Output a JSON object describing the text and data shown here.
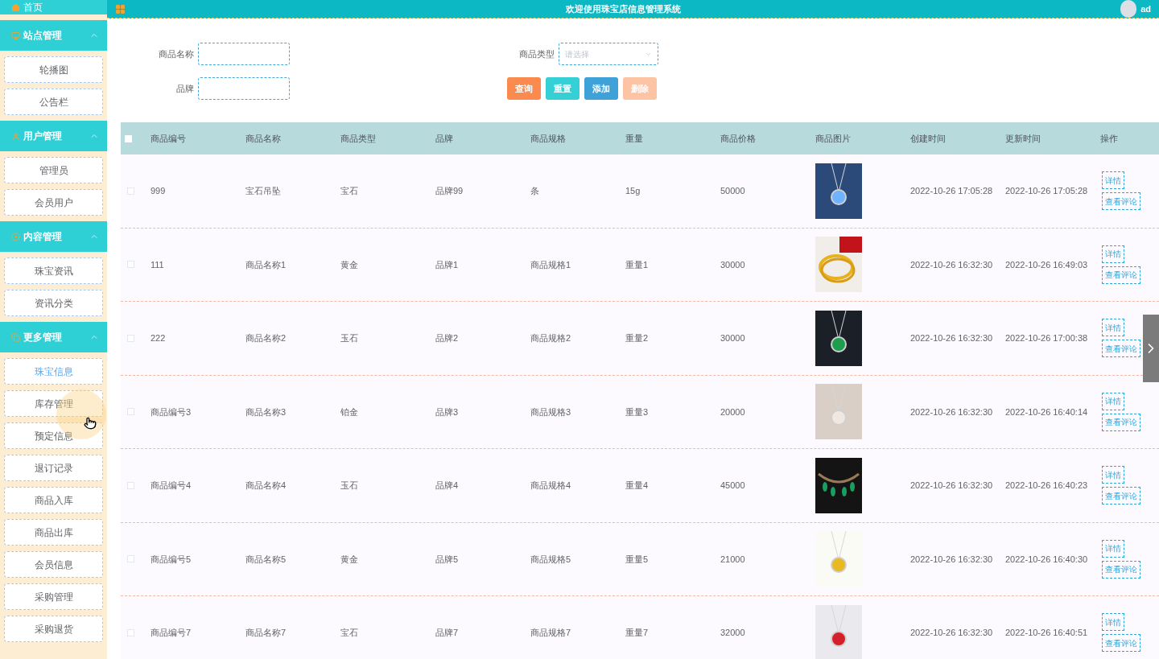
{
  "sidebar": {
    "home": "首页",
    "groups": [
      {
        "title": "站点管理",
        "expanded": true,
        "items": [
          {
            "label": "轮播图",
            "selected": false
          },
          {
            "label": "公告栏",
            "selected": false
          }
        ]
      },
      {
        "title": "用户管理",
        "expanded": true,
        "items": [
          {
            "label": "管理员",
            "selected": false
          },
          {
            "label": "会员用户",
            "selected": false
          }
        ]
      },
      {
        "title": "内容管理",
        "expanded": true,
        "items": [
          {
            "label": "珠宝资讯",
            "selected": false
          },
          {
            "label": "资讯分类",
            "selected": false
          }
        ]
      },
      {
        "title": "更多管理",
        "expanded": true,
        "items": [
          {
            "label": "珠宝信息",
            "selected": true
          },
          {
            "label": "库存管理",
            "selected": false
          },
          {
            "label": "预定信息",
            "selected": false
          },
          {
            "label": "退订记录",
            "selected": false
          },
          {
            "label": "商品入库",
            "selected": false
          },
          {
            "label": "商品出库",
            "selected": false
          },
          {
            "label": "会员信息",
            "selected": false
          },
          {
            "label": "采购管理",
            "selected": false
          },
          {
            "label": "采购退货",
            "selected": false
          }
        ]
      }
    ]
  },
  "header": {
    "title": "欢迎使用珠宝店信息管理系统",
    "user": "ad"
  },
  "filters": {
    "name_label": "商品名称",
    "brand_label": "品牌",
    "type_label": "商品类型",
    "type_placeholder": "请选择"
  },
  "buttons": [
    {
      "label": "查询",
      "kind": "query",
      "disabled": false
    },
    {
      "label": "重置",
      "kind": "reset",
      "disabled": false
    },
    {
      "label": "添加",
      "kind": "add",
      "disabled": false
    },
    {
      "label": "删除",
      "kind": "delete",
      "disabled": true
    }
  ],
  "table": {
    "select_all_checked": false,
    "columns": [
      "商品编号",
      "商品名称",
      "商品类型",
      "品牌",
      "商品规格",
      "重量",
      "商品价格",
      "商品图片",
      "创建时间",
      "更新时间",
      "操作"
    ],
    "rows": [
      {
        "checked": false,
        "cells": [
          "999",
          "宝石吊坠",
          "宝石",
          "品牌99",
          "条",
          "15g",
          "50000"
        ],
        "created": "2022-10-26 17:05:28",
        "updated": "2022-10-26 17:05:28",
        "actions": [
          "详情",
          "查看评论"
        ]
      },
      {
        "checked": false,
        "cells": [
          "111",
          "商品名称1",
          "黄金",
          "品牌1",
          "商品规格1",
          "重量1",
          "30000"
        ],
        "created": "2022-10-26 16:32:30",
        "updated": "2022-10-26 16:49:03",
        "actions": [
          "详情",
          "查看评论"
        ]
      },
      {
        "checked": false,
        "cells": [
          "222",
          "商品名称2",
          "玉石",
          "品牌2",
          "商品规格2",
          "重量2",
          "30000"
        ],
        "created": "2022-10-26 16:32:30",
        "updated": "2022-10-26 17:00:38",
        "actions": [
          "详情",
          "查看评论"
        ]
      },
      {
        "checked": false,
        "cells": [
          "商品编号3",
          "商品名称3",
          "铂金",
          "品牌3",
          "商品规格3",
          "重量3",
          "20000"
        ],
        "created": "2022-10-26 16:32:30",
        "updated": "2022-10-26 16:40:14",
        "actions": [
          "详情",
          "查看评论"
        ]
      },
      {
        "checked": false,
        "cells": [
          "商品编号4",
          "商品名称4",
          "玉石",
          "品牌4",
          "商品规格4",
          "重量4",
          "45000"
        ],
        "created": "2022-10-26 16:32:30",
        "updated": "2022-10-26 16:40:23",
        "actions": [
          "详情",
          "查看评论"
        ]
      },
      {
        "checked": false,
        "cells": [
          "商品编号5",
          "商品名称5",
          "黄金",
          "品牌5",
          "商品规格5",
          "重量5",
          "21000"
        ],
        "created": "2022-10-26 16:32:30",
        "updated": "2022-10-26 16:40:30",
        "actions": [
          "详情",
          "查看评论"
        ]
      },
      {
        "checked": false,
        "cells": [
          "商品编号7",
          "商品名称7",
          "宝石",
          "品牌7",
          "商品规格7",
          "重量7",
          "32000"
        ],
        "created": "2022-10-26 16:32:30",
        "updated": "2022-10-26 16:40:51",
        "actions": [
          "详情",
          "查看评论"
        ]
      }
    ]
  }
}
